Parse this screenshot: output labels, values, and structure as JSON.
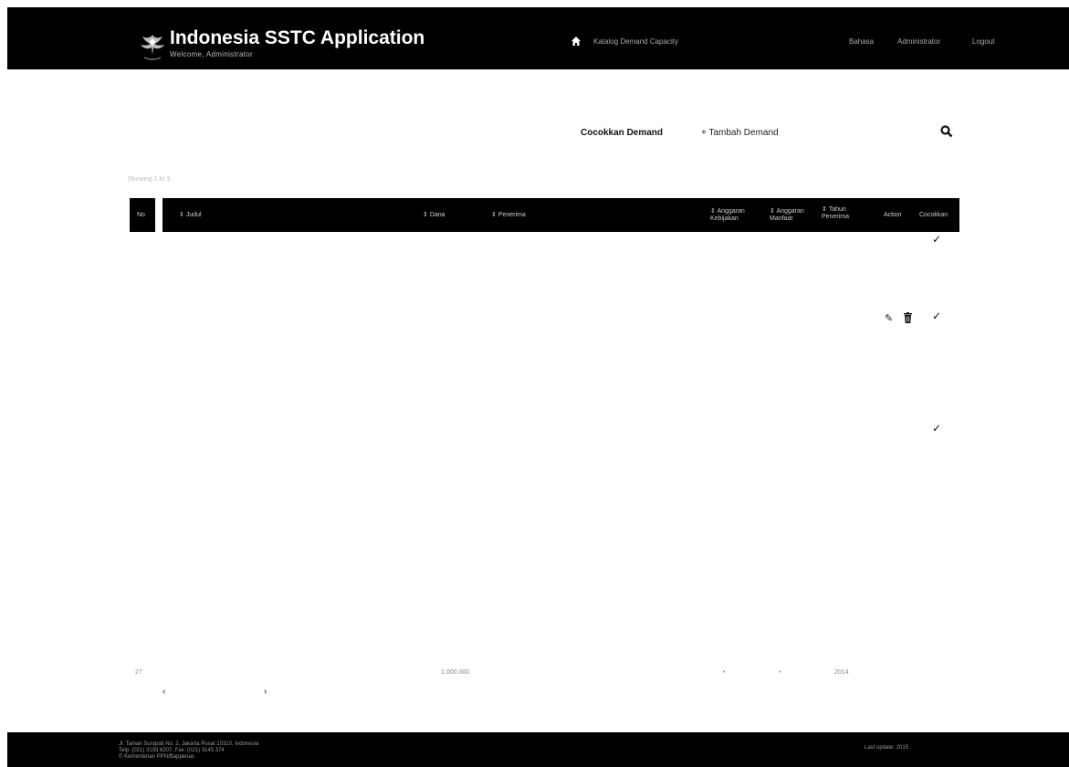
{
  "header": {
    "title": "Indonesia SSTC Application",
    "subtitle": "Welcome, Administrator",
    "nav_main": "Katalog Demand Capacity",
    "nav_items": [
      "Bahasa",
      "Administrator",
      "Logout"
    ]
  },
  "toolbar": {
    "match_label": "Cocokkan Demand",
    "add_label": "+ Tambah Demand"
  },
  "list_info": "Showing 1 to 3",
  "table": {
    "columns": [
      "No",
      "Judul",
      "Dana",
      "Penerima",
      "Anggaran Kebijakan",
      "Anggaran Manfaat",
      "Tahun Penerima",
      "Action",
      "Cocokkan"
    ],
    "rows": [
      {
        "checked": "✓",
        "has_actions": false
      },
      {
        "checked": "✓",
        "has_actions": true
      },
      {
        "checked": "✓",
        "has_actions": false
      }
    ],
    "footer_values": [
      "27",
      "1.000.000",
      "•",
      "•",
      "2014"
    ]
  },
  "pager": {
    "prev": "‹",
    "next": "›"
  },
  "footer": {
    "lines": [
      "Jl. Taman Suropati No. 2, Jakarta Pusat 10310, Indonesia",
      "Telp: (021) 3193 6207, Fax: (021) 3145 374",
      "© Kementerian PPN/Bappenas"
    ],
    "right": "Last update: 2015"
  }
}
